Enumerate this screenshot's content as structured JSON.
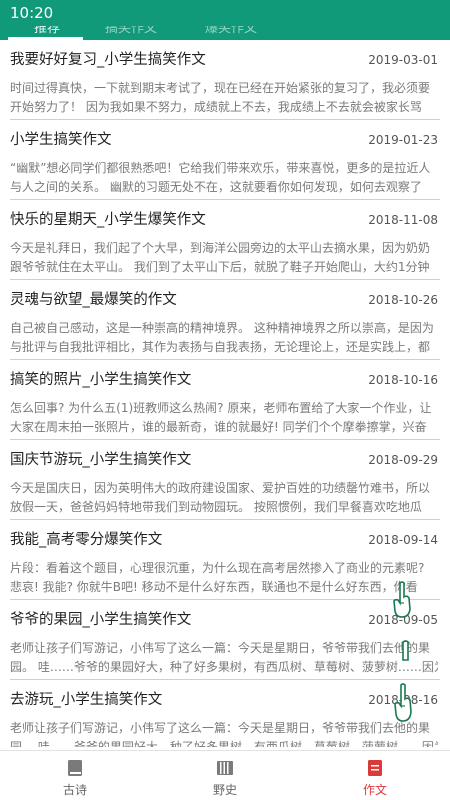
{
  "status_bar": {
    "time": "10:20"
  },
  "tabs": [
    {
      "label": "推荐"
    },
    {
      "label": "搞笑作文"
    },
    {
      "label": "爆笑作文"
    }
  ],
  "items": [
    {
      "title": "我要好好复习_小学生搞笑作文",
      "date": "2019-03-01",
      "excerpt": [
        "时间过得真快，一下就到期末考试了，现在已经在开始紧张的复习了，我必须要",
        "开始努力了！ 因为我如果不努力，成绩就上不去，我成绩上不去就会被家长骂"
      ]
    },
    {
      "title": "小学生搞笑作文",
      "date": "2019-01-23",
      "excerpt": [
        "“幽默”想必同学们都很熟悉吧！它给我们带来欢乐，带来喜悦，更多的是拉近人",
        "与人之间的关系。 幽默的习题无处不在，这就要看你如何发现，如何去观察了"
      ]
    },
    {
      "title": "快乐的星期天_小学生爆笑作文",
      "date": "2018-11-08",
      "excerpt": [
        "今天是礼拜日，我们起了个大早，到海洋公园旁边的太平山去摘水果，因为奶奶",
        "跟爷爷就住在太平山。 我们到了太平山下后，就脱了鞋子开始爬山，大约1分钟"
      ]
    },
    {
      "title": "灵魂与欲望_最爆笑的作文",
      "date": "2018-10-26",
      "excerpt": [
        "自己被自己感动，这是一种崇高的精神境界。 这种精神境界之所以崇高，是因为",
        "与批评与自我批评相比，其作为表扬与自我表扬，无论理论上，还是实践上，都"
      ]
    },
    {
      "title": "搞笑的照片_小学生搞笑作文",
      "date": "2018-10-16",
      "excerpt": [
        "怎么回事? 为什么五(1)班教师这么热闹? 原来，老师布置给了大家一个作业，让",
        "大家在周末拍一张照片，谁的最新奇，谁的就最好! 同学们个个摩拳擦掌，兴奋"
      ]
    },
    {
      "title": "国庆节游玩_小学生搞笑作文",
      "date": "2018-09-29",
      "excerpt": [
        "今天是国庆日，因为英明伟大的政府建设国家、爱护百姓的功绩罄竹难书，所以",
        "放假一天，爸爸妈妈特地带我们到动物园玩。 按照惯例，我们早餐喜欢吃地瓜"
      ]
    },
    {
      "title": "我能_高考零分爆笑作文",
      "date": "2018-09-14",
      "excerpt": [
        "片段：看着这个题目，心理很沉重，为什么现在高考居然掺入了商业的元素呢?",
        "悲哀! 我能? 你就牛B吧! 移动不是什么好东西，联通也不是什么好东西，你看"
      ]
    },
    {
      "title": "爷爷的果园_小学生搞笑作文",
      "date": "2018-09-05",
      "excerpt": [
        "老师让孩子们写游记，小伟写了这么一篇：今天是星期日，爷爷带我们去他的果",
        "园。 哇……爷爷的果园好大，种了好多果树，有西瓜树、草莓树、菠萝树……因为"
      ]
    },
    {
      "title": "去游玩_小学生搞笑作文",
      "date": "2018-08-16",
      "excerpt": [
        "老师让孩子们写游记，小伟写了这么一篇：今天是星期日，爷爷带我们去他的果",
        "园。 哇……爷爷的果园好大，种了好多果树，有西瓜树、草莓树、菠萝树……因为"
      ]
    }
  ],
  "bottom_nav": [
    {
      "label": "古诗",
      "icon": "book-icon"
    },
    {
      "label": "野史",
      "icon": "scroll-icon"
    },
    {
      "label": "作文",
      "icon": "essay-icon",
      "active": true
    }
  ],
  "colors": {
    "header": "#119a79",
    "active_nav": "#d93a3a"
  }
}
